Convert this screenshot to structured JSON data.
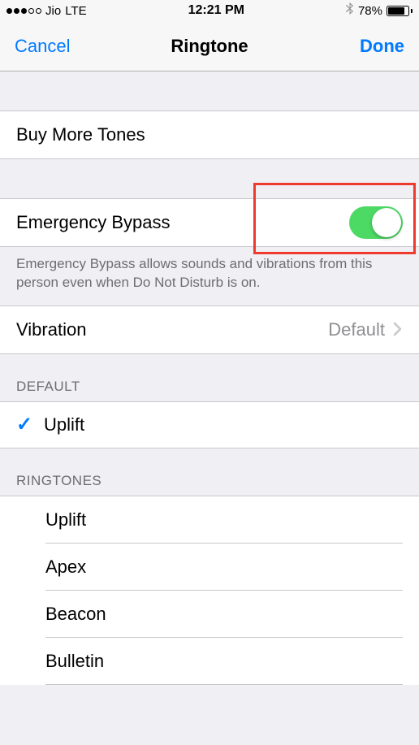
{
  "status": {
    "carrier": "Jio",
    "network": "LTE",
    "time": "12:21 PM",
    "battery_pct": "78%"
  },
  "nav": {
    "cancel": "Cancel",
    "title": "Ringtone",
    "done": "Done"
  },
  "buy_more": "Buy More Tones",
  "emergency": {
    "label": "Emergency Bypass",
    "footer": "Emergency Bypass allows sounds and vibrations from this person even when Do Not Disturb is on."
  },
  "vibration": {
    "label": "Vibration",
    "value": "Default"
  },
  "sections": {
    "default": "DEFAULT",
    "ringtones": "RINGTONES"
  },
  "default_tone": "Uplift",
  "ringtones": [
    "Uplift",
    "Apex",
    "Beacon",
    "Bulletin"
  ]
}
